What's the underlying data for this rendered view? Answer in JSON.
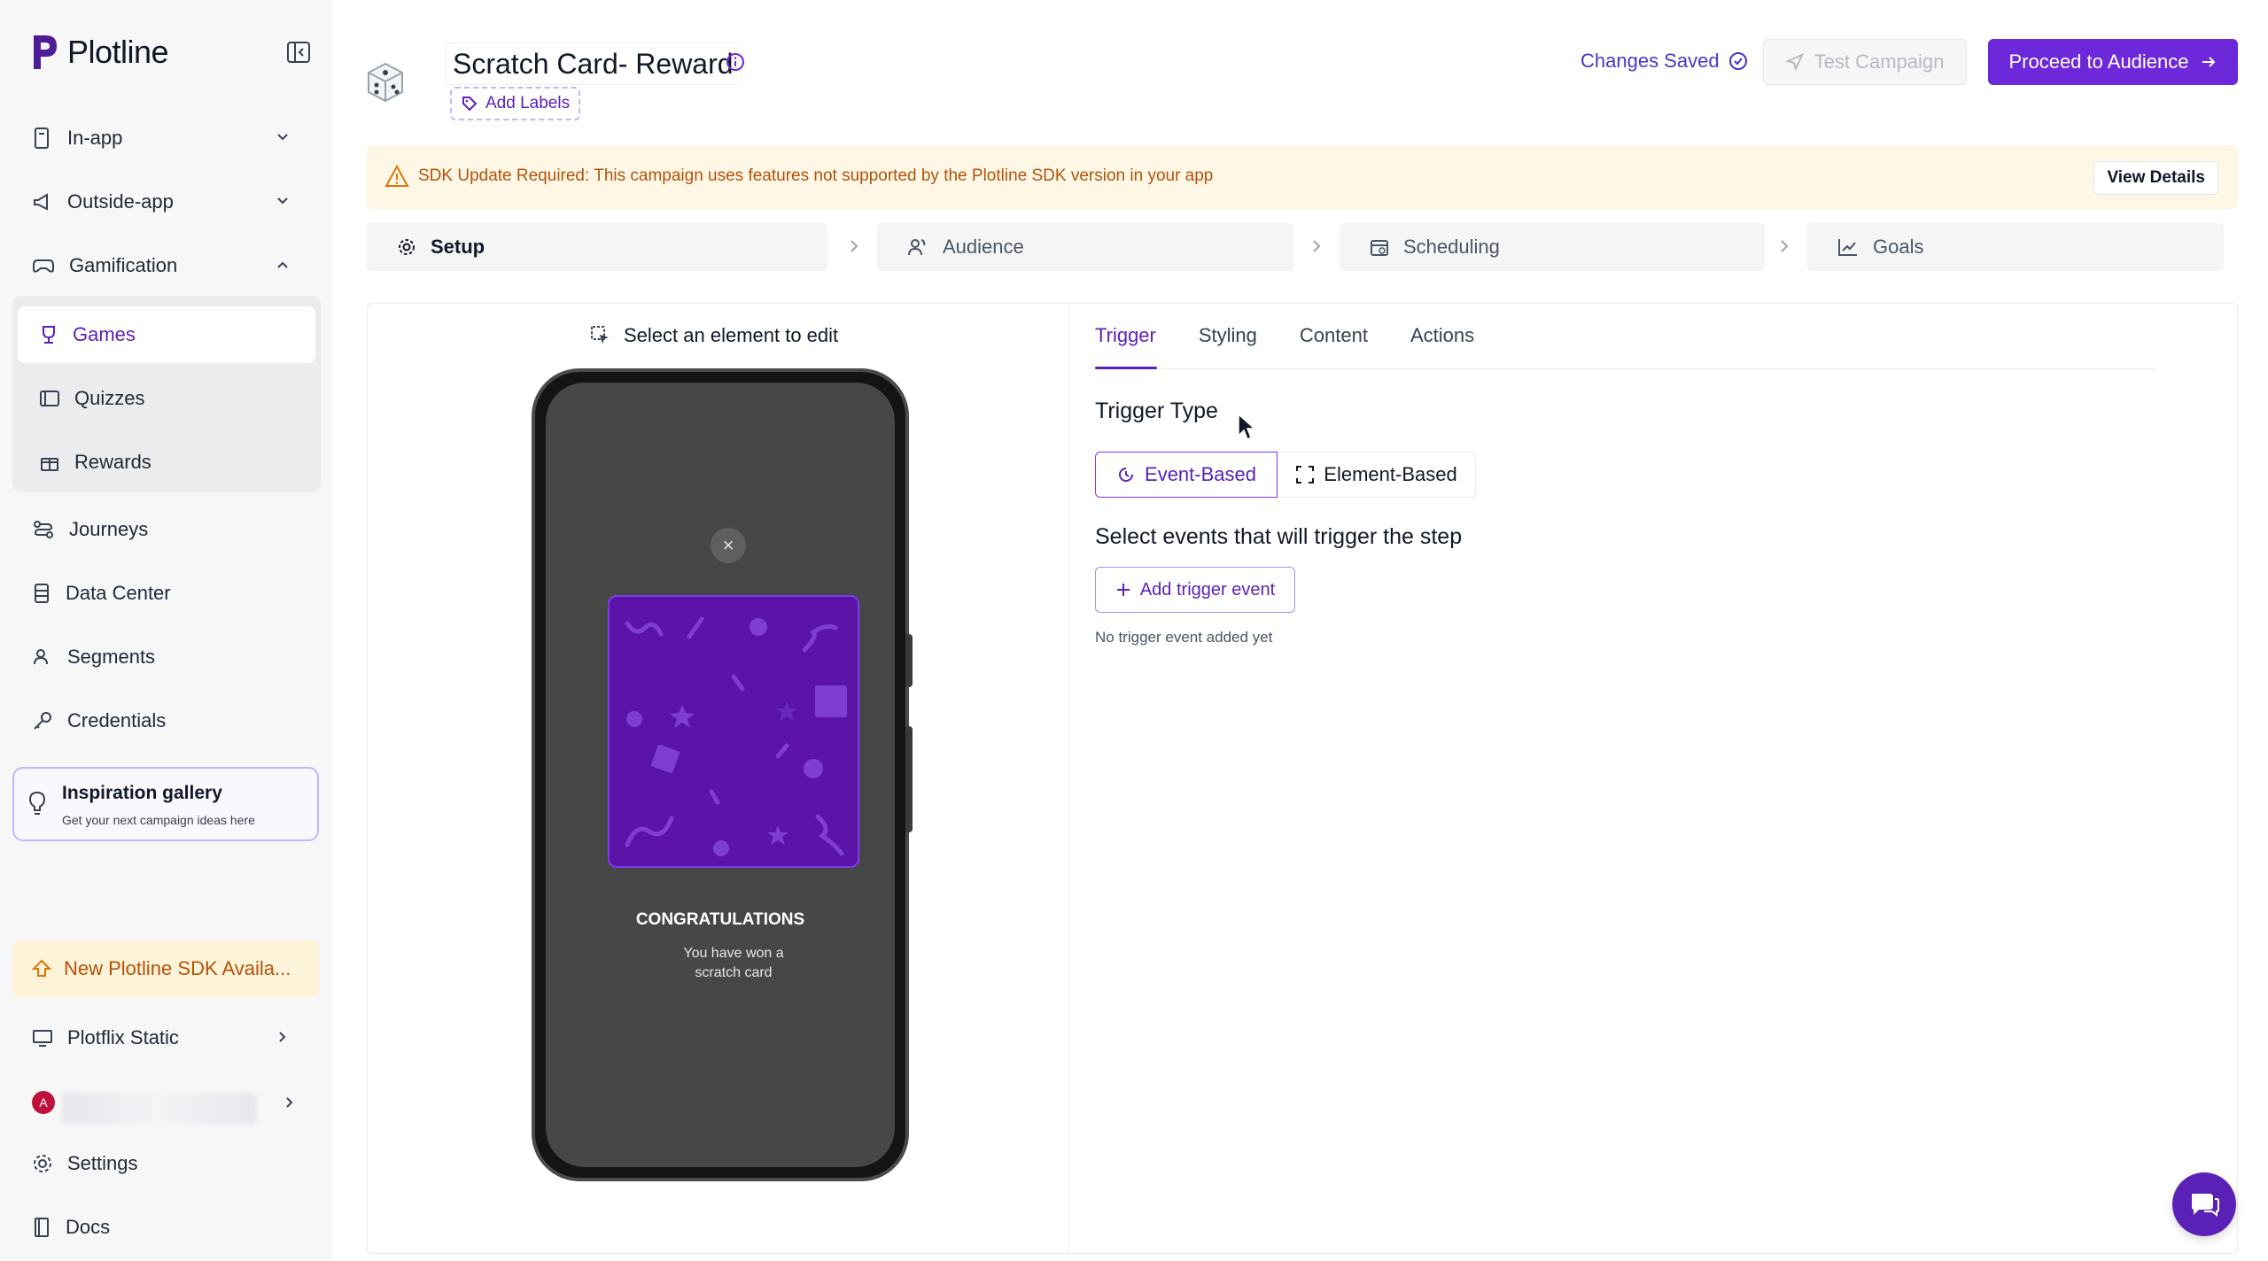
{
  "sidebar": {
    "brand": "Plotline",
    "items": [
      {
        "label": "In-app"
      },
      {
        "label": "Outside-app"
      },
      {
        "label": "Gamification"
      },
      {
        "label": "Journeys"
      },
      {
        "label": "Data Center"
      },
      {
        "label": "Segments"
      },
      {
        "label": "Credentials"
      },
      {
        "label": "Plotflix Static"
      },
      {
        "label": "Settings"
      },
      {
        "label": "Docs"
      }
    ],
    "sub_items": [
      {
        "label": "Games"
      },
      {
        "label": "Quizzes"
      },
      {
        "label": "Rewards"
      }
    ],
    "inspiration": {
      "title": "Inspiration gallery",
      "subtitle": "Get your next campaign ideas here"
    },
    "sdk_banner": "New Plotline SDK Availa...",
    "account_avatar": "A"
  },
  "header": {
    "campaign_title": "Scratch Card- Reward",
    "add_labels": "Add Labels",
    "changes_saved": "Changes Saved",
    "test_campaign": "Test Campaign",
    "proceed": "Proceed to Audience"
  },
  "warning": {
    "text": "SDK Update Required: This campaign uses features not supported by the Plotline SDK version in your app",
    "action": "View Details"
  },
  "steps": [
    {
      "label": "Setup"
    },
    {
      "label": "Audience"
    },
    {
      "label": "Scheduling"
    },
    {
      "label": "Goals"
    }
  ],
  "preview": {
    "select_element": "Select an element to edit",
    "close": "×",
    "congrats": "CONGRATULATIONS",
    "message": "You have won a scratch card"
  },
  "editor": {
    "tabs": [
      {
        "label": "Trigger"
      },
      {
        "label": "Styling"
      },
      {
        "label": "Content"
      },
      {
        "label": "Actions"
      }
    ],
    "trigger_type_label": "Trigger Type",
    "event_based": "Event-Based",
    "element_based": "Element-Based",
    "select_events_label": "Select events that will trigger the step",
    "add_trigger": "Add trigger event",
    "empty_state": "No trigger event added yet"
  },
  "colors": {
    "accent": "#6d28d9",
    "warning": "#b45309",
    "card": "#5b13a8"
  }
}
